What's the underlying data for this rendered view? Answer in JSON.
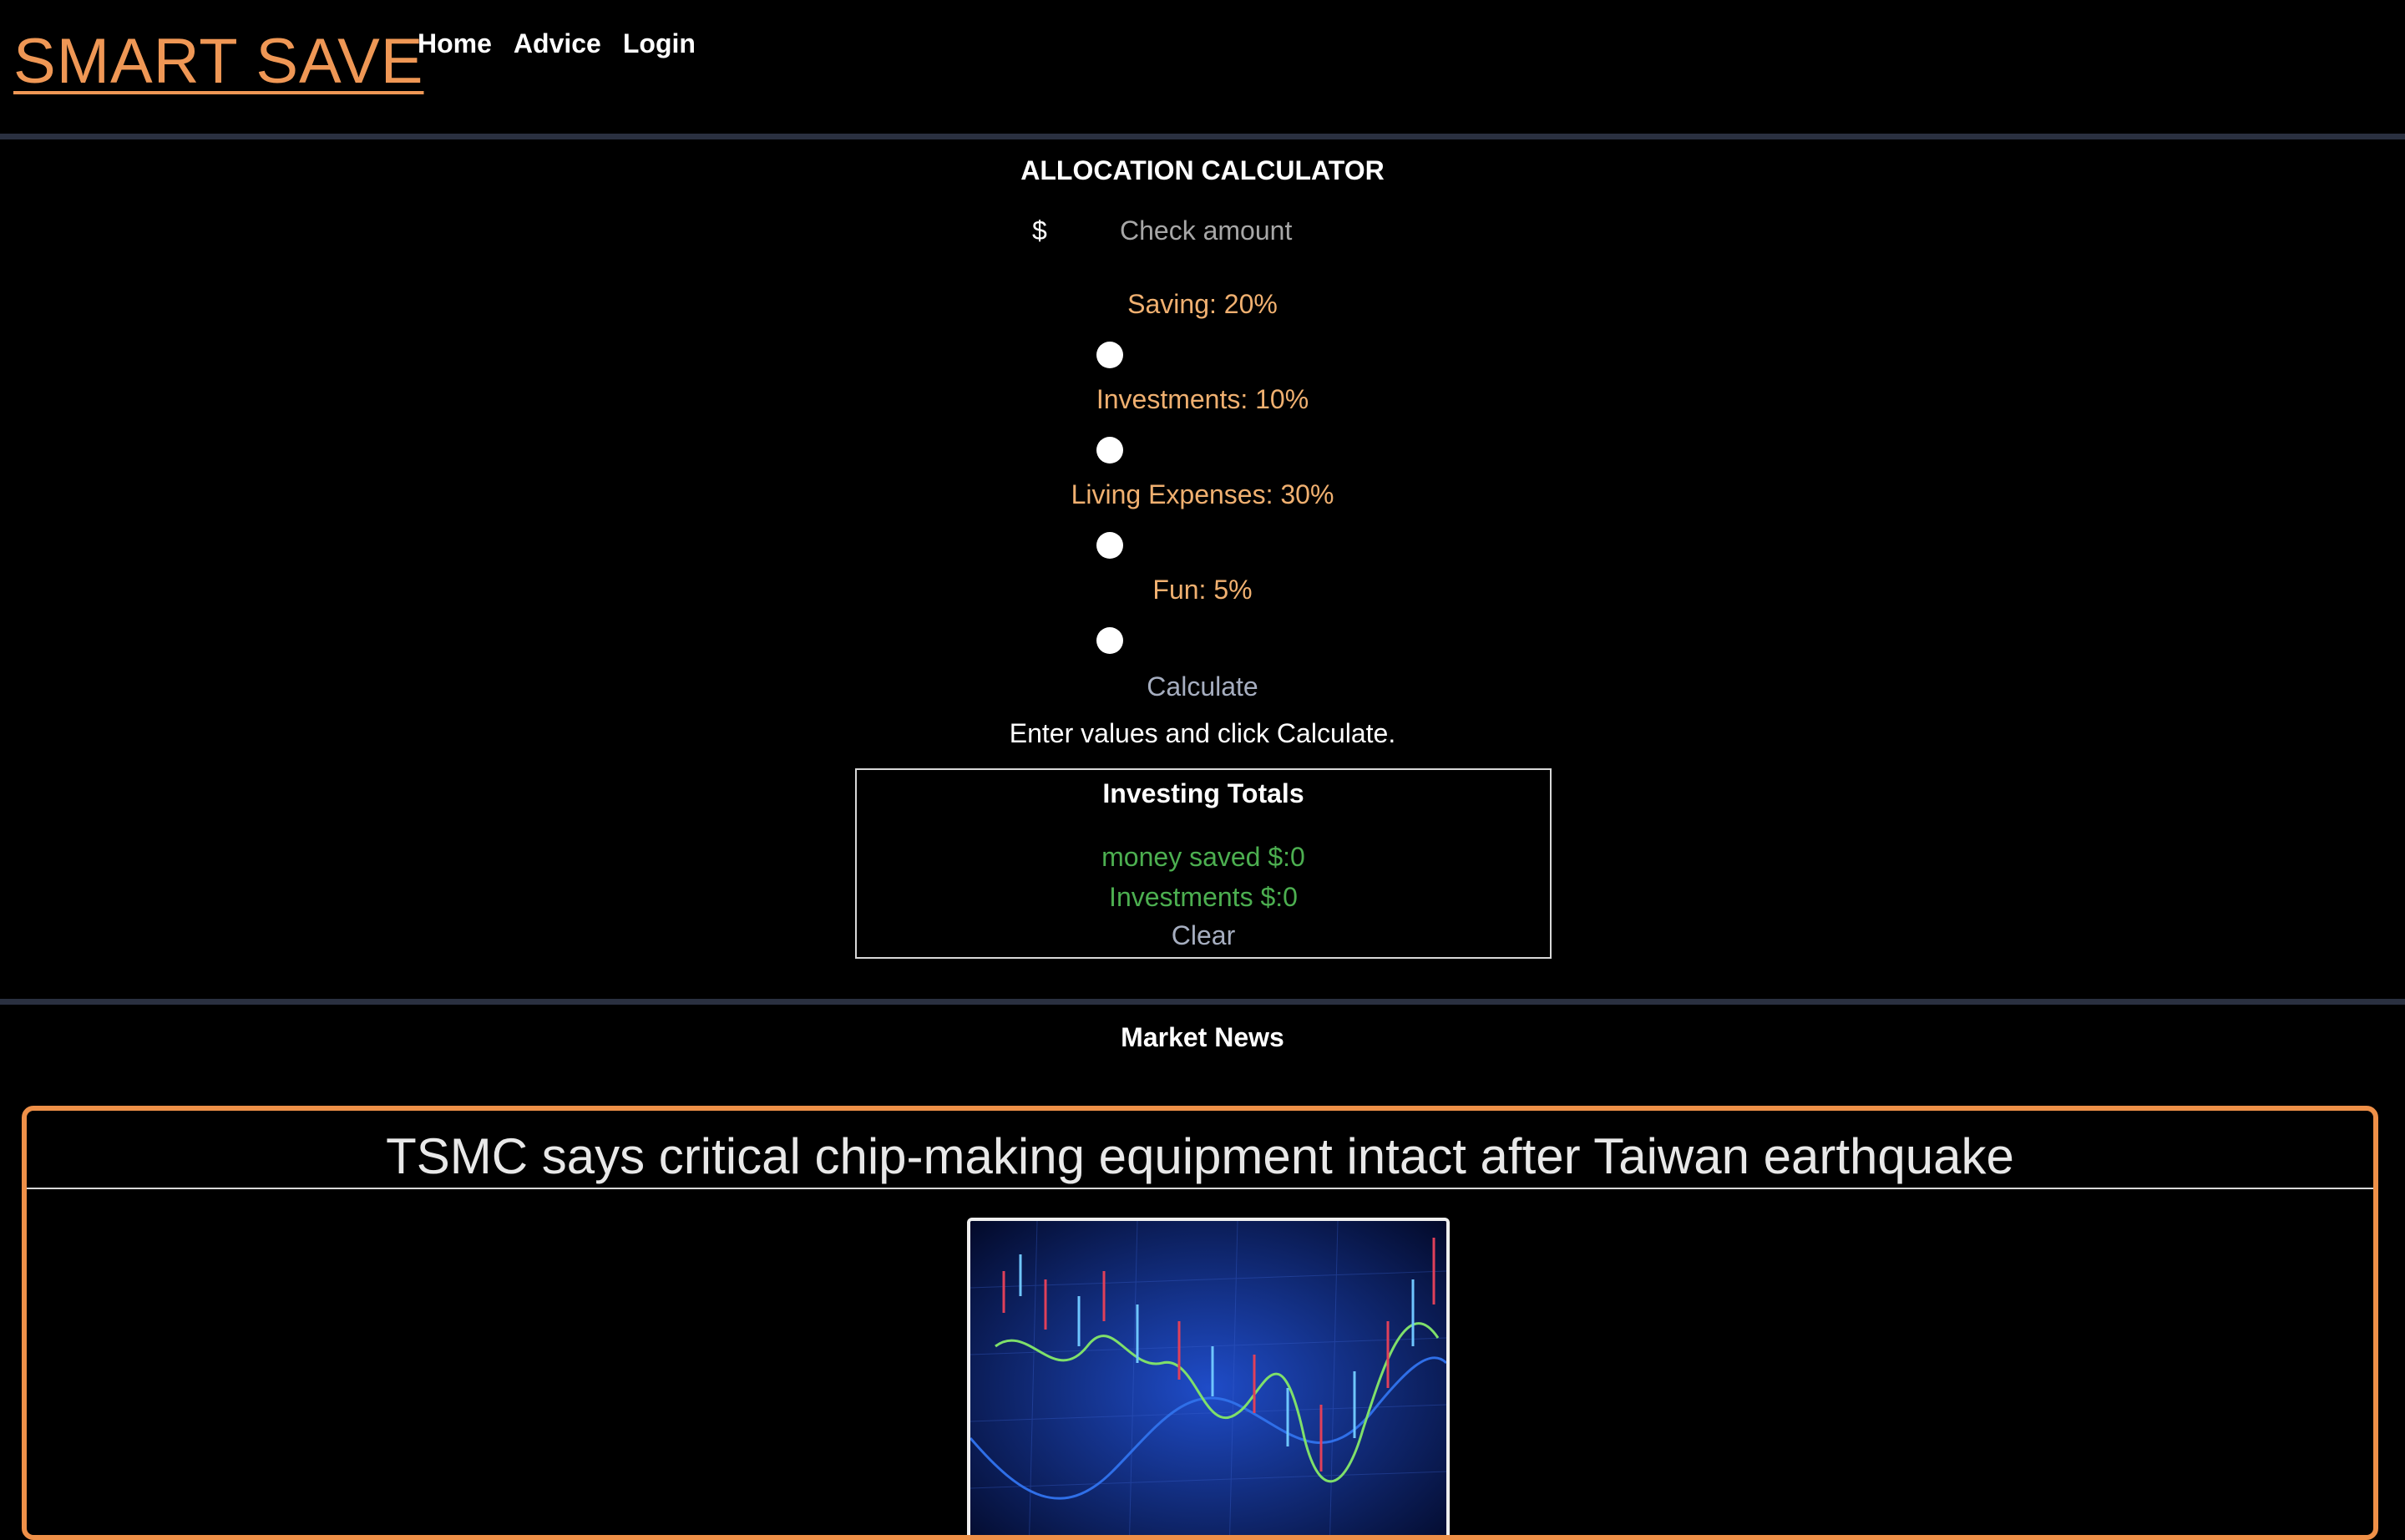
{
  "header": {
    "logo": "SMART SAVE",
    "nav": [
      "Home",
      "Advice",
      "Login"
    ]
  },
  "calculator": {
    "title": "ALLOCATION CALCULATOR",
    "currency_symbol": "$",
    "amount_placeholder": "Check amount",
    "allocations": [
      {
        "label": "Saving: 20%",
        "percent": 20
      },
      {
        "label": "Investments: 10%",
        "percent": 10
      },
      {
        "label": "Living Expenses: 30%",
        "percent": 30
      },
      {
        "label": "Fun: 5%",
        "percent": 5
      }
    ],
    "calculate_label": "Calculate",
    "hint": "Enter values and click Calculate."
  },
  "totals": {
    "title": "Investing Totals",
    "money_saved": "money saved $:0",
    "investments": "Investments $:0",
    "clear_label": "Clear"
  },
  "news": {
    "section_title": "Market News",
    "articles": [
      {
        "headline": "TSMC says critical chip-making equipment intact after Taiwan earthquake"
      }
    ]
  },
  "colors": {
    "accent": "#ef9755",
    "allocation_label": "#f0b070",
    "totals_text": "#4caf50",
    "divider": "#2a3040"
  }
}
